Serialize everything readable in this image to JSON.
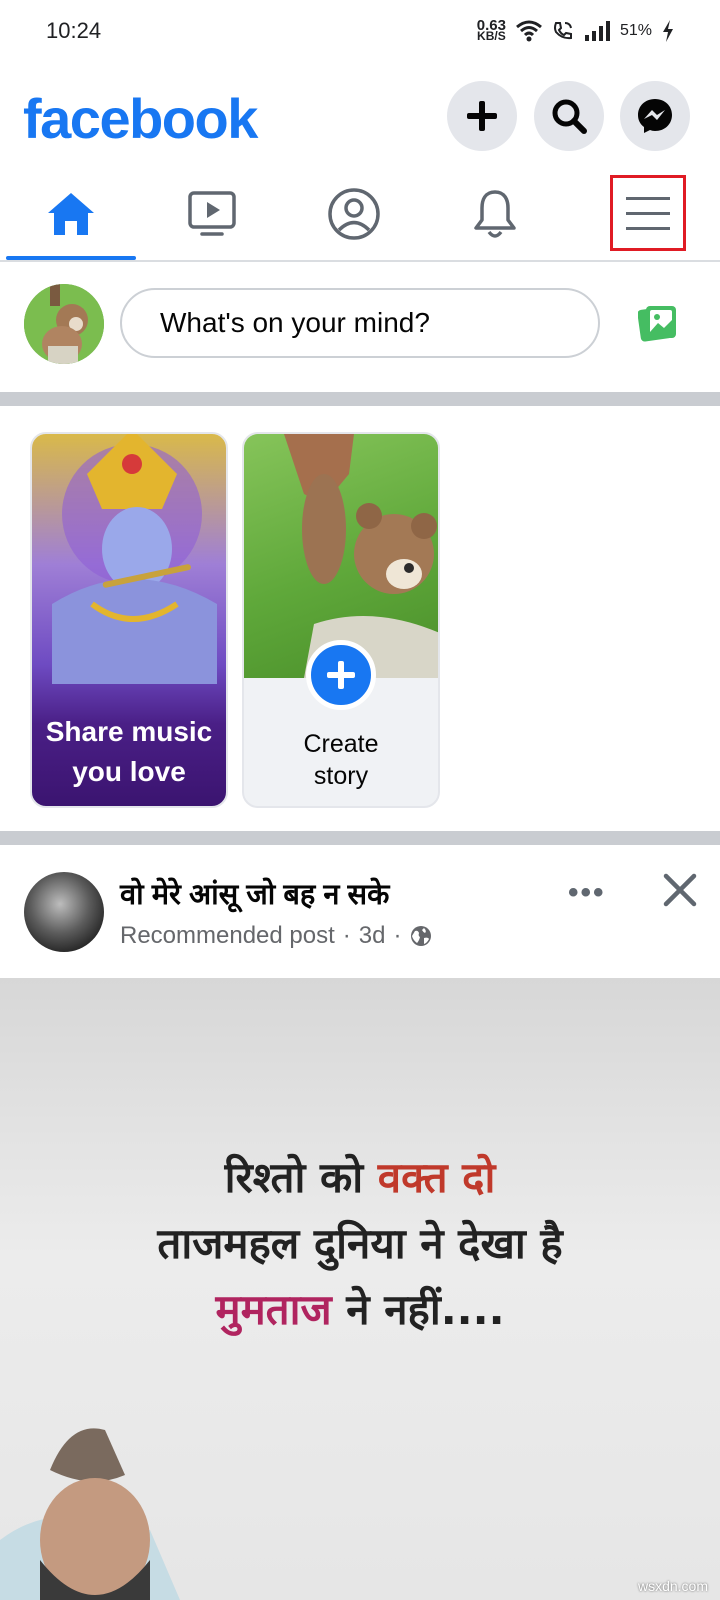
{
  "status_bar": {
    "time": "10:24",
    "net_speed_value": "0.63",
    "net_speed_unit": "KB/S",
    "battery": "51%"
  },
  "header": {
    "logo": "facebook",
    "brand_color": "#1877f2"
  },
  "tabs": [
    {
      "name": "home",
      "icon": "home-icon",
      "selected": true
    },
    {
      "name": "video",
      "icon": "video-icon",
      "selected": false
    },
    {
      "name": "profile",
      "icon": "profile-icon",
      "selected": false
    },
    {
      "name": "notifications",
      "icon": "bell-icon",
      "selected": false
    },
    {
      "name": "menu",
      "icon": "hamburger-menu-icon",
      "selected": false,
      "highlighted": true
    }
  ],
  "composer": {
    "placeholder": "What's on your mind?"
  },
  "stories": [
    {
      "label": "Share music you love",
      "label_line1": "Share music",
      "label_line2": "you love"
    },
    {
      "label": "Create story",
      "label_line1": "Create",
      "label_line2": "story"
    }
  ],
  "post": {
    "title": "वो मेरे आंसू जो बह न सके",
    "subtitle": "Recommended post",
    "age": "3d",
    "separator": "·",
    "more_label": "•••",
    "quote": {
      "line1_a": "रिश्तो को ",
      "line1_b": "वक्त दो",
      "line2": "ताजमहल दुनिया ने देखा है",
      "line3_a": "मुमताज",
      "line3_b": " ने नहीं...."
    }
  },
  "watermark": "wsxdn.com"
}
